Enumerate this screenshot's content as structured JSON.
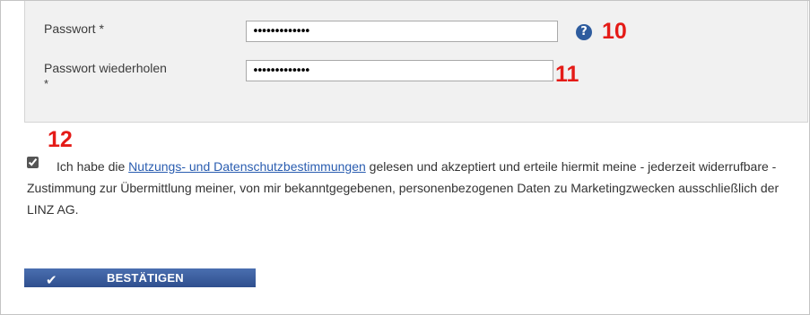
{
  "form": {
    "password_label": "Passwort *",
    "password_value": "•••••••••••••",
    "repeat_label": "Passwort wiederholen",
    "repeat_label_required": "*",
    "repeat_value": "•••••••••••••",
    "help_icon_glyph": "?"
  },
  "annotations": {
    "step_10": "10",
    "step_11": "11",
    "step_12": "12"
  },
  "consent": {
    "checked": true,
    "text_before": "Ich habe die ",
    "link_text": "Nutzungs- und Datenschutzbestimmungen",
    "text_after": " gelesen und akzeptiert und erteile hiermit meine - jederzeit widerrufbare - Zustimmung zur Übermittlung meiner, von mir bekanntgegebenen, personenbezogenen Daten zu Marketingzwecken ausschließlich der LINZ AG."
  },
  "actions": {
    "confirm_label": "BESTÄTIGEN",
    "confirm_icon": "checkmark-icon"
  },
  "colors": {
    "panel_bg": "#f1f1f1",
    "annotation_red": "#e41b17",
    "link_blue": "#2a5db0",
    "button_blue": "#3a5c9e",
    "help_icon_blue": "#2e5c9e"
  }
}
